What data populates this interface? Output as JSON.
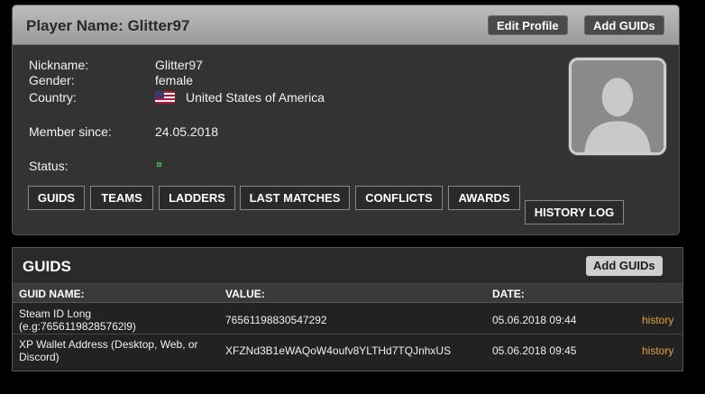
{
  "profile": {
    "title": "Player Name: Glitter97",
    "edit_profile": "Edit Profile",
    "add_guids": "Add GUIDs",
    "fields": {
      "nickname_label": "Nickname:",
      "nickname": "Glitter97",
      "gender_label": "Gender:",
      "gender": "female",
      "country_label": "Country:",
      "country": "United States of America",
      "member_since_label": "Member since:",
      "member_since": "24.05.2018",
      "status_label": "Status:"
    },
    "tabs": [
      "GUIDS",
      "TEAMS",
      "LADDERS",
      "LAST MATCHES",
      "CONFLICTS",
      "AWARDS",
      "HISTORY LOG"
    ]
  },
  "guids": {
    "title": "GUIDS",
    "add_guids": "Add GUIDs",
    "columns": [
      "GUID NAME:",
      "VALUE:",
      "DATE:"
    ],
    "rows": [
      {
        "name_line1": "Steam ID Long",
        "name_line2": "(e.g:76561198285762l9)",
        "value": "76561198830547292",
        "date": "05.06.2018 09:44",
        "action": "history"
      },
      {
        "name_line1": "XP Wallet Address (Desktop, Web, or",
        "name_line2": "Discord)",
        "value": "XFZNd3B1eWAQoW4oufv8YLTHd7TQJnhxUS",
        "date": "05.06.2018 09:45",
        "action": "history"
      }
    ]
  },
  "colors": {
    "history_link": "#e6a23c",
    "status_online": "#2e7d32"
  }
}
